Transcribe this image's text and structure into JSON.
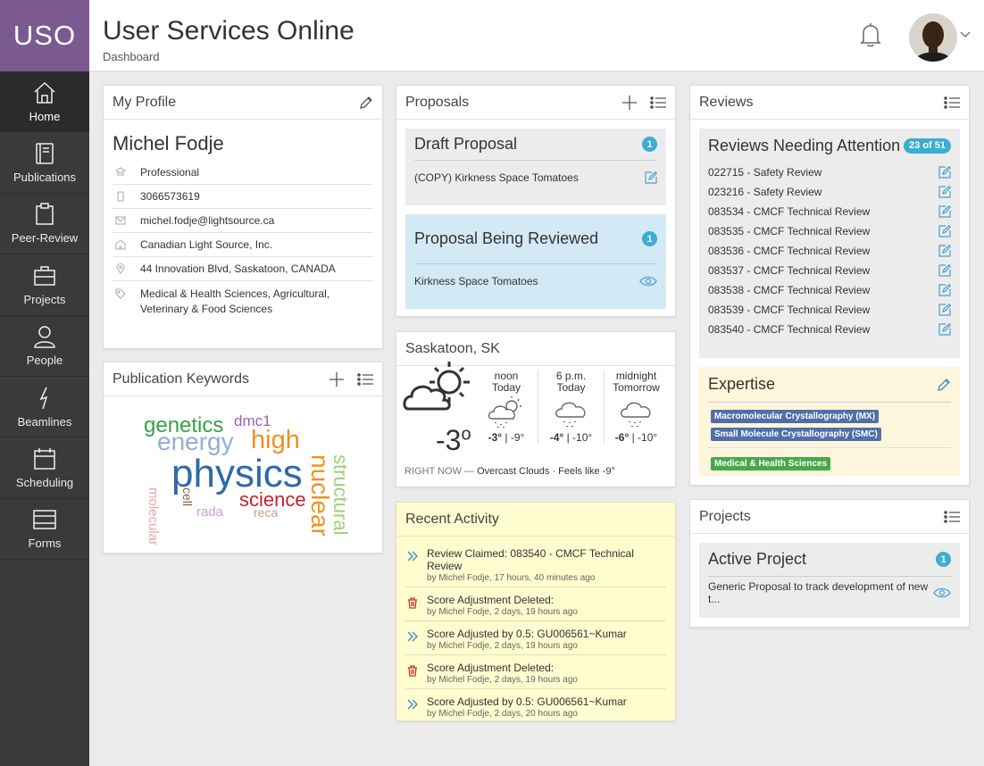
{
  "app": {
    "logo": "USO",
    "title": "User Services Online",
    "breadcrumb": "Dashboard"
  },
  "nav": [
    {
      "label": "Home",
      "icon": "home-icon"
    },
    {
      "label": "Publications",
      "icon": "book-icon"
    },
    {
      "label": "Peer-Review",
      "icon": "clipboard-icon"
    },
    {
      "label": "Projects",
      "icon": "briefcase-icon"
    },
    {
      "label": "People",
      "icon": "person-icon"
    },
    {
      "label": "Beamlines",
      "icon": "lightning-icon"
    },
    {
      "label": "Scheduling",
      "icon": "calendar-icon"
    },
    {
      "label": "Forms",
      "icon": "forms-icon"
    }
  ],
  "profile": {
    "title": "My Profile",
    "name": "Michel Fodje",
    "fields": [
      {
        "icon": "hat-icon",
        "value": "Professional"
      },
      {
        "icon": "phone-icon",
        "value": "3066573619"
      },
      {
        "icon": "mail-icon",
        "value": "michel.fodje@lightsource.ca"
      },
      {
        "icon": "building-icon",
        "value": "Canadian Light Source, Inc."
      },
      {
        "icon": "pin-icon",
        "value": "44 Innovation Blvd, Saskatoon, CANADA"
      },
      {
        "icon": "tag-icon",
        "value": "Medical & Health Sciences, Agricultural, Veterinary & Food Sciences"
      }
    ]
  },
  "keywords": {
    "title": "Publication Keywords",
    "words": [
      {
        "text": "genetics",
        "color": "#3c9e4a"
      },
      {
        "text": "dmc1",
        "color": "#9c5fb5"
      },
      {
        "text": "energy",
        "color": "#8fb0d6"
      },
      {
        "text": "high",
        "color": "#f0901e"
      },
      {
        "text": "nuclear",
        "color": "#f0901e"
      },
      {
        "text": "structural",
        "color": "#9ed07a"
      },
      {
        "text": "physics",
        "color": "#2e6aa8"
      },
      {
        "text": "molecular",
        "color": "#f2a2a2"
      },
      {
        "text": "science",
        "color": "#c8202c"
      },
      {
        "text": "cell",
        "color": "#8a5a3a"
      },
      {
        "text": "rada",
        "color": "#c9a0d6"
      },
      {
        "text": "reca",
        "color": "#c8a08a"
      }
    ]
  },
  "proposals": {
    "title": "Proposals",
    "draft": {
      "title": "Draft Proposal",
      "count": "1",
      "items": [
        "(COPY) Kirkness Space Tomatoes"
      ]
    },
    "review": {
      "title": "Proposal Being Reviewed",
      "count": "1",
      "items": [
        "Kirkness Space Tomatoes"
      ]
    }
  },
  "weather": {
    "location": "Saskatoon, SK",
    "current_temp": "-3",
    "current_unit": "o",
    "now_label": "RIGHT NOW —",
    "now_desc": "Overcast Clouds · Feels like -9°",
    "forecast": [
      {
        "time": "noon",
        "day": "Today",
        "hi": "-3°",
        "lo": "-9°"
      },
      {
        "time": "6 p.m.",
        "day": "Today",
        "hi": "-4°",
        "lo": "-10°"
      },
      {
        "time": "midnight",
        "day": "Tomorrow",
        "hi": "-6°",
        "lo": "-10°"
      }
    ]
  },
  "activity": {
    "title": "Recent Activity",
    "items": [
      {
        "icon": "forward-icon",
        "text": "Review Claimed:   083540 - CMCF Technical Review",
        "meta": "by Michel Fodje, 17 hours, 40 minutes ago"
      },
      {
        "icon": "trash-icon",
        "text": "Score Adjustment Deleted:",
        "meta": "by Michel Fodje, 2 days, 19 hours ago"
      },
      {
        "icon": "forward-icon",
        "text": "Score Adjusted by 0.5:   GU006561~Kumar",
        "meta": "by Michel Fodje, 2 days, 19 hours ago"
      },
      {
        "icon": "trash-icon",
        "text": "Score Adjustment Deleted:",
        "meta": "by Michel Fodje, 2 days, 19 hours ago"
      },
      {
        "icon": "forward-icon",
        "text": "Score Adjusted by 0.5:   GU006561~Kumar",
        "meta": "by Michel Fodje, 2 days, 20 hours ago"
      }
    ]
  },
  "reviews": {
    "title": "Reviews",
    "attention": {
      "title": "Reviews Needing Attention",
      "count": "23 of 51",
      "items": [
        "022715 - Safety Review",
        "023216 - Safety Review",
        "083534 - CMCF Technical Review",
        "083535 - CMCF Technical Review",
        "083536 - CMCF Technical Review",
        "083537 - CMCF Technical Review",
        "083538 - CMCF Technical Review",
        "083539 - CMCF Technical Review",
        "083540 - CMCF Technical Review"
      ]
    },
    "expertise": {
      "title": "Expertise",
      "techniques": [
        "Macromolecular Crystallography (MX)",
        "Small Molecule Crystallography (SMC)"
      ],
      "areas": [
        "Medical & Health Sciences"
      ]
    }
  },
  "projects": {
    "title": "Projects",
    "active": {
      "title": "Active Project",
      "count": "1",
      "items": [
        "Generic Proposal to track development of new t..."
      ]
    }
  },
  "colors": {
    "sidebar": "#3a3a3a",
    "logo": "#7a5a91",
    "badge": "#3cadd3",
    "review_bg": "#d3e9f5",
    "activity_bg": "#fffccf",
    "expertise_bg": "#fdf6dc"
  }
}
